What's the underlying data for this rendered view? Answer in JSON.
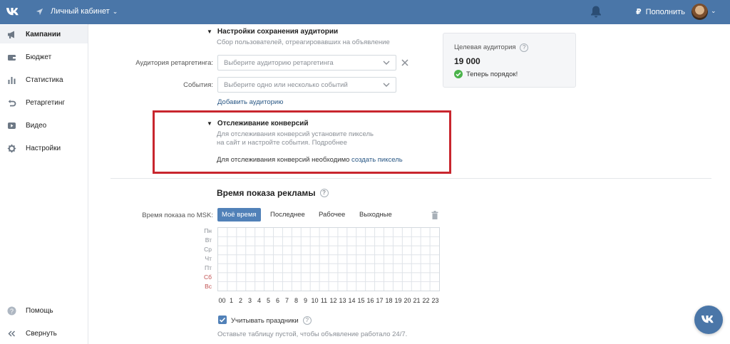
{
  "header": {
    "cabinet_label": "Личный кабинет",
    "topup_currency": "₽",
    "topup_label": "Пополнить"
  },
  "sidebar": {
    "items": [
      {
        "label": "Кампании",
        "icon": "megaphone-icon"
      },
      {
        "label": "Бюджет",
        "icon": "wallet-icon"
      },
      {
        "label": "Статистика",
        "icon": "bar-chart-icon"
      },
      {
        "label": "Ретаргетинг",
        "icon": "retarget-arrow-icon"
      },
      {
        "label": "Видео",
        "icon": "play-icon"
      },
      {
        "label": "Настройки",
        "icon": "gear-icon"
      }
    ],
    "help_label": "Помощь",
    "collapse_label": "Свернуть"
  },
  "audience_save": {
    "title": "Настройки сохранения аудитории",
    "subtitle": "Сбор пользователей, отреагировавших на объявление",
    "retarget_label": "Аудитория ретаргетинга:",
    "retarget_placeholder": "Выберите аудиторию ретаргетинга",
    "events_label": "События:",
    "events_placeholder": "Выберите одно или несколько событий",
    "add_audience_link": "Добавить аудиторию"
  },
  "conversion": {
    "title": "Отслеживание конверсий",
    "desc_line1": "Для отслеживания конверсий установите пиксель",
    "desc_line2": "на сайт и настройте события.",
    "more_link": "Подробнее",
    "need_text": "Для отслеживания конверсий необходимо",
    "create_pixel_link": "создать пиксель"
  },
  "target_card": {
    "title": "Целевая аудитория",
    "help": "?",
    "value": "19 000",
    "status": "Теперь порядок!"
  },
  "schedule": {
    "title": "Время показа рекламы",
    "help": "?",
    "msk_label": "Время показа по MSK:",
    "tabs": [
      "Моё время",
      "Последнее",
      "Рабочее",
      "Выходные"
    ],
    "days": [
      "Пн",
      "Вт",
      "Ср",
      "Чт",
      "Пт",
      "Сб",
      "Вс"
    ],
    "hours": [
      "00",
      "1",
      "2",
      "3",
      "4",
      "5",
      "6",
      "7",
      "8",
      "9",
      "10",
      "11",
      "12",
      "13",
      "14",
      "15",
      "16",
      "17",
      "18",
      "19",
      "20",
      "21",
      "22",
      "23"
    ],
    "holidays_label": "Учитывать праздники",
    "empty_hint": "Оставьте таблицу пустой, чтобы объявление работало 24/7."
  },
  "colors": {
    "header_bg": "#4a76a8",
    "accent": "#5181b8",
    "highlight_box": "#c8262e",
    "success": "#4bb34b"
  }
}
